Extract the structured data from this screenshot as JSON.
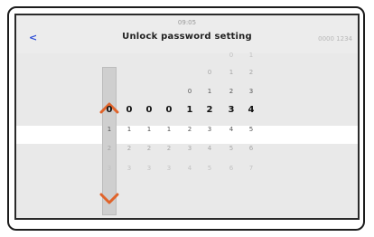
{
  "header": {
    "time": "09:05",
    "title": "Unlock password setting",
    "back_label": "<",
    "code": "0000 1234"
  },
  "picker": {
    "row_above_3": [
      "",
      "",
      "",
      "",
      "",
      "",
      "0",
      "1"
    ],
    "row_above_2": [
      "",
      "",
      "",
      "",
      "",
      "0",
      "1",
      "2"
    ],
    "row_above_1": [
      "",
      "",
      "",
      "",
      "0",
      "1",
      "2",
      "3"
    ],
    "selected": [
      "0",
      "0",
      "0",
      "0",
      "1",
      "2",
      "3",
      "4"
    ],
    "row_below_1": [
      "1",
      "1",
      "1",
      "1",
      "2",
      "3",
      "4",
      "5"
    ],
    "row_below_2": [
      "2",
      "2",
      "2",
      "2",
      "3",
      "4",
      "5",
      "6"
    ],
    "row_below_3": [
      "3",
      "3",
      "3",
      "3",
      "4",
      "5",
      "6",
      "7"
    ]
  },
  "icons": {
    "up": "chevron-up-icon",
    "down": "chevron-down-icon"
  },
  "colors": {
    "accent": "#e0632a",
    "back": "#2a4bd6"
  }
}
